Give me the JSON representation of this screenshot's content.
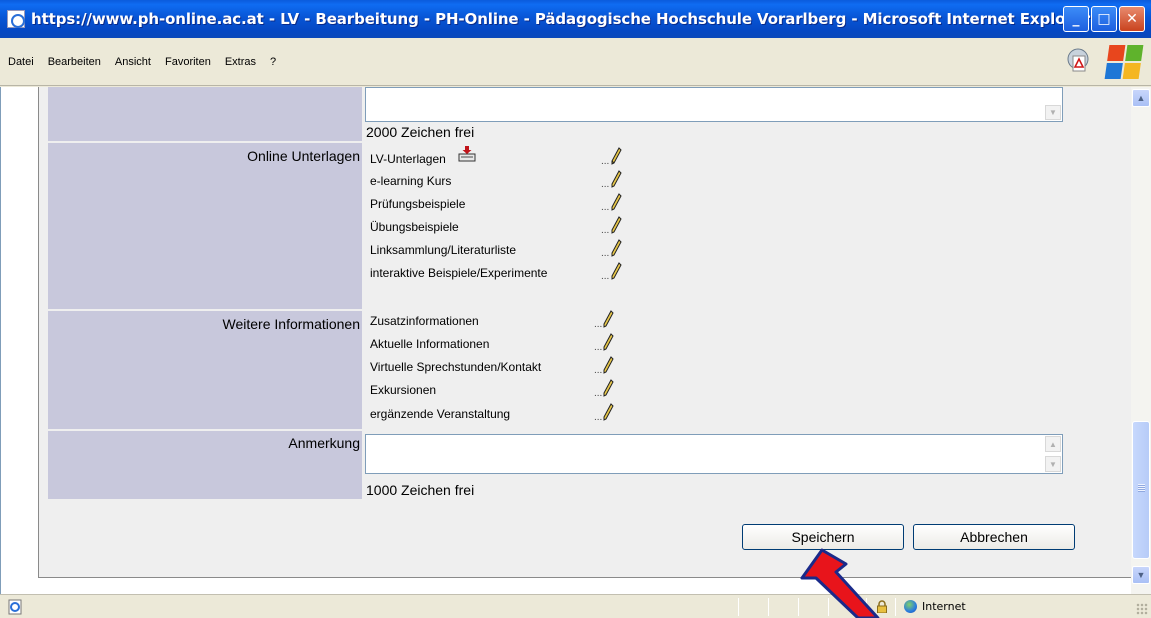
{
  "window": {
    "title": "https://www.ph-online.ac.at - LV - Bearbeitung - PH-Online - Pädagogische Hochschule Vorarlberg - Microsoft Internet Explorer",
    "minimize": "_",
    "maximize": "□",
    "close": "✕"
  },
  "menu": {
    "items": [
      "Datei",
      "Bearbeiten",
      "Ansicht",
      "Favoriten",
      "Extras",
      "?"
    ]
  },
  "form": {
    "first_textarea_counter": "2000 Zeichen frei",
    "online_unterlagen": {
      "label": "Online Unterlagen",
      "items": [
        {
          "label": "LV-Unterlagen",
          "icon": "download-icon"
        },
        {
          "label": "e-learning Kurs"
        },
        {
          "label": "Prüfungsbeispiele"
        },
        {
          "label": "Übungsbeispiele"
        },
        {
          "label": "Linksammlung/Literaturliste"
        },
        {
          "label": "interaktive Beispiele/Experimente"
        }
      ]
    },
    "weitere_informationen": {
      "label": "Weitere Informationen",
      "items": [
        {
          "label": "Zusatzinformationen"
        },
        {
          "label": "Aktuelle Informationen"
        },
        {
          "label": "Virtuelle Sprechstunden/Kontakt"
        },
        {
          "label": "Exkursionen"
        },
        {
          "label": "ergänzende Veranstaltung"
        }
      ]
    },
    "anmerkung": {
      "label": "Anmerkung",
      "counter": "1000 Zeichen frei"
    },
    "edit_icon": "pencil-icon",
    "edit_dots": "...",
    "save_button": "Speichern",
    "cancel_button": "Abbrechen"
  },
  "statusbar": {
    "zone": "Internet"
  },
  "colors": {
    "label_bg": "#C8C8DC",
    "panel_bg": "#EFEFEF",
    "titlebar": "#0856D6",
    "arrow": "#E8141B"
  }
}
